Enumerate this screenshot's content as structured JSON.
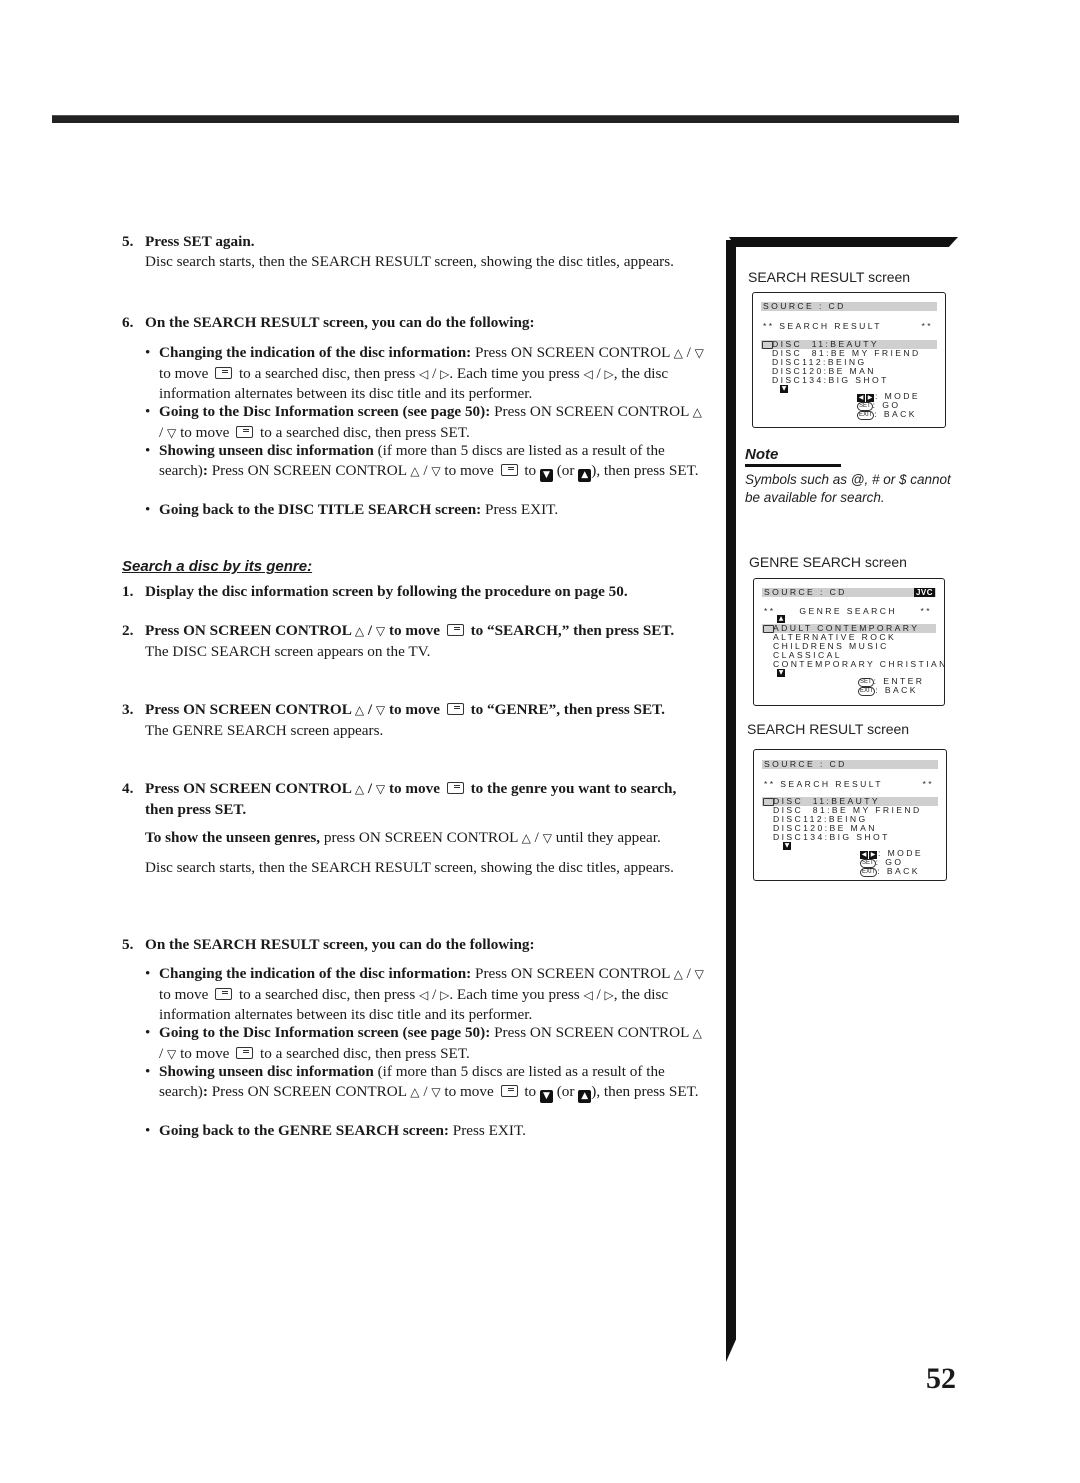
{
  "page": {
    "number": "52"
  },
  "symbols": {
    "up": "△",
    "down": "▽",
    "left": "◁",
    "right": "▷",
    "filled_down": "▼",
    "filled_up": "▲"
  },
  "part1": {
    "step5": {
      "num": "5.",
      "title": "Press SET again.",
      "text": "Disc search starts, then the SEARCH RESULT screen, showing the disc titles, appears."
    },
    "step6": {
      "num": "6.",
      "title": "On the SEARCH RESULT screen, you can do the following:"
    },
    "bullets": [
      {
        "bold": "Changing the indication of the disc information:",
        "t1": " Press ON SCREEN CONTROL",
        "t2": " to move",
        "t3": " to a searched disc, then press",
        "t4": ". Each time you press",
        "t5": ", the disc information alternates between its disc title and its performer."
      },
      {
        "bold": "Going to the Disc Information screen (see page 50):",
        "t1": " Press ON SCREEN CONTROL",
        "t2": " to move",
        "t3": " to a searched disc, then press SET."
      },
      {
        "bold": "Showing unseen disc information",
        "t1": " (if more than 5 discs are listed as a result of the search)",
        "t1b": ": ",
        "t2": "Press ON SCREEN CONTROL",
        "t3": " to move",
        "t4": " to",
        "t5": " (or",
        "t6": "), then press SET."
      },
      {
        "bold": "Going back to the DISC TITLE SEARCH screen:",
        "t1": " Press EXIT."
      }
    ]
  },
  "genre_section": {
    "title": "Search a disc by its genre:",
    "step1": {
      "num": "1.",
      "title": "Display the disc information screen by following the procedure on page 50."
    },
    "step2": {
      "num": "2.",
      "t1": "Press ON SCREEN CONTROL",
      "t2": " to move",
      "t3": " to “SEARCH,” then press SET.",
      "text": "The DISC SEARCH screen appears on the TV."
    },
    "step3": {
      "num": "3.",
      "t1": "Press ON SCREEN CONTROL",
      "t2": " to move",
      "t3": " to “GENRE”, then press SET.",
      "text": "The GENRE SEARCH screen appears."
    },
    "step4": {
      "num": "4.",
      "t1": "Press ON SCREEN CONTROL",
      "t2": " to move",
      "t3": " to the genre you want to search, then press SET.",
      "unseen_bold": "To show the unseen genres,",
      "unseen_text": " press ON SCREEN CONTROL",
      "unseen_end": " until they appear.",
      "text": "Disc search starts, then the SEARCH RESULT screen, showing the disc titles, appears."
    },
    "step5": {
      "num": "5.",
      "title": "On the SEARCH RESULT screen, you can do the following:"
    },
    "bullets": [
      {
        "bold": "Changing the indication of the disc information:",
        "t1": " Press ON SCREEN CONTROL",
        "t2": " to move",
        "t3": " to a searched disc, then press",
        "t4": ". Each time you press",
        "t5": ", the disc information alternates between its disc title and its performer."
      },
      {
        "bold": "Going to the Disc Information screen (see page 50):",
        "t1": " Press ON SCREEN CONTROL",
        "t2": " to move",
        "t3": " to a searched disc, then press SET."
      },
      {
        "bold": "Showing unseen disc information",
        "t1": " (if more than 5 discs are listed as a result of the search)",
        "t1b": ": ",
        "t2": "Press ON SCREEN CONTROL",
        "t3": " to move",
        "t4": " to",
        "t5": " (or",
        "t6": "), then press SET."
      },
      {
        "bold": "Going back to the GENRE SEARCH screen:",
        "t1": " Press EXIT."
      }
    ]
  },
  "sidebar": {
    "search_result_1": {
      "caption": "SEARCH RESULT screen",
      "source": "SOURCE :  CD",
      "header_left": "** SEARCH RESULT",
      "header_right": "**",
      "rows": [
        "DISC  11:BEAUTY",
        "DISC  81:BE MY FRIEND",
        "DISC112:BEING",
        "DISC120:BE MAN",
        "DISC134:BIG SHOT"
      ],
      "legend": [
        {
          "key": "◀▶",
          "label": ": MODE"
        },
        {
          "key": "SET",
          "label": ": GO"
        },
        {
          "key": "EXIT",
          "label": ": BACK"
        }
      ]
    },
    "note": {
      "heading": "Note",
      "text": "Symbols such as @, # or $ cannot be available for search."
    },
    "genre_search": {
      "caption": "GENRE SEARCH screen",
      "source": "SOURCE :  CD",
      "brand": "JVC",
      "header_left": "**     GENRE SEARCH",
      "header_right": "**",
      "rows": [
        "ADULT CONTEMPORARY",
        "ALTERNATIVE ROCK",
        "CHILDRENS MUSIC",
        "CLASSICAL",
        "CONTEMPORARY CHRISTIAN"
      ],
      "legend": [
        {
          "key": "SET",
          "label": ": ENTER"
        },
        {
          "key": "EXIT",
          "label": ": BACK"
        }
      ]
    },
    "search_result_2": {
      "caption": "SEARCH RESULT screen",
      "source": "SOURCE :  CD",
      "header_left": "** SEARCH RESULT",
      "header_right": "**",
      "rows": [
        "DISC  11:BEAUTY",
        "DISC  81:BE MY FRIEND",
        "DISC112:BEING",
        "DISC120:BE MAN",
        "DISC134:BIG SHOT"
      ],
      "legend": [
        {
          "key": "◀▶",
          "label": ": MODE"
        },
        {
          "key": "SET",
          "label": ": GO"
        },
        {
          "key": "EXIT",
          "label": ": BACK"
        }
      ]
    }
  }
}
